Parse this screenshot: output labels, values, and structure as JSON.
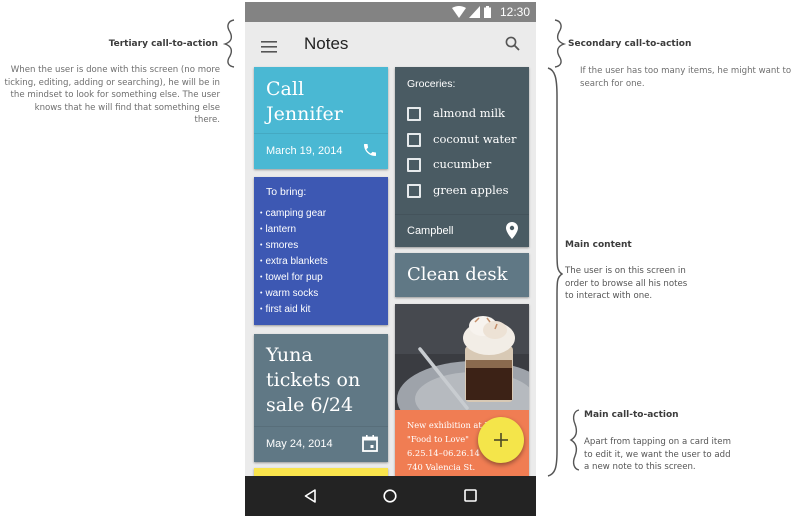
{
  "annotations": {
    "tertiary": {
      "title": "Tertiary call-to-action",
      "lines": [
        "When the user is done with this screen (no more",
        "ticking, editing, adding or searching), he will be in",
        "the mindset to look for something else. The user",
        "knows that he will find that something else",
        "there."
      ]
    },
    "secondary": {
      "title": "Secondary call-to-action",
      "lines": [
        "If the user has too many items, he might want to",
        "search for one."
      ]
    },
    "main_content": {
      "title": "Main content",
      "lines": [
        "The user is on this screen in",
        "order to browse all his notes",
        "to interact with one."
      ]
    },
    "main_cta": {
      "title": "Main call-to-action",
      "lines": [
        "Apart from tapping on a card item",
        "to edit it, we want the user to add",
        "a new note to this screen."
      ]
    }
  },
  "status_bar": {
    "time": "12:30",
    "icons": [
      "wifi-icon",
      "signal-icon",
      "battery-icon"
    ]
  },
  "app_bar": {
    "title": "Notes",
    "menu_icon": "menu-icon",
    "search_icon": "search-icon"
  },
  "colors": {
    "cyan": "#4ab8d3",
    "indigo": "#3d58b3",
    "bluegrey": "#607885",
    "darkgrey": "#4a5b63",
    "orange": "#f07d53",
    "yellow": "#f4e54a"
  },
  "cards": {
    "call_jennifer": {
      "title_lines": [
        "Call",
        "Jennifer"
      ],
      "date": "March 19, 2014",
      "icon": "phone-icon"
    },
    "to_bring": {
      "heading": "To bring:",
      "items": [
        "camping gear",
        "lantern",
        "smores",
        "extra blankets",
        "towel for pup",
        "warm socks",
        "first aid kit"
      ]
    },
    "yuna": {
      "title_lines": [
        "Yuna",
        "tickets on",
        "sale 6/24"
      ],
      "date": "May 24, 2014",
      "icon": "calendar-icon"
    },
    "groceries": {
      "heading": "Groceries:",
      "items": [
        {
          "label": "almond milk",
          "checked": false
        },
        {
          "label": "coconut water",
          "checked": false
        },
        {
          "label": "cucumber",
          "checked": false
        },
        {
          "label": "green apples",
          "checked": false
        }
      ],
      "location": "Campbell",
      "icon": "location-pin-icon"
    },
    "clean_desk": {
      "title": "Clean desk"
    },
    "exhibition": {
      "image": "dessert-in-glass-photo",
      "lines": [
        "New exhibition at De",
        "\"Food to Love\"",
        "6.25.14–06.26.14",
        "740 Valencia St."
      ]
    }
  },
  "fab": {
    "label": "+",
    "icon": "add-icon"
  },
  "nav_bar": {
    "buttons": [
      "back-icon",
      "home-icon",
      "recents-icon"
    ]
  }
}
